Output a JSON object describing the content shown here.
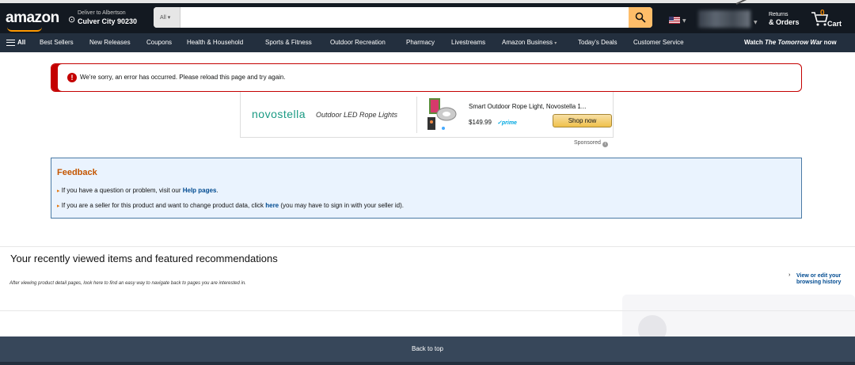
{
  "header": {
    "logo": "amazon",
    "deliver_line1": "Deliver to Albertson",
    "deliver_line2": "Culver City 90230",
    "search_category": "All",
    "search_value": "",
    "returns_line1": "Returns",
    "returns_line2": "& Orders",
    "cart_count": "0",
    "cart_label": "Cart"
  },
  "subnav": {
    "all": "All",
    "items": [
      "Best Sellers",
      "New Releases",
      "Coupons",
      "Health & Household",
      "Sports & Fitness",
      "Outdoor Recreation",
      "Pharmacy",
      "Livestreams",
      "Amazon Business",
      "Today's Deals",
      "Customer Service"
    ],
    "promo_prefix": "Watch ",
    "promo_title": "The Tomorrow War",
    "promo_suffix": " now"
  },
  "error": {
    "message": "We're sorry, an error has occurred. Please reload this page and try again."
  },
  "ad": {
    "brand": "novostella",
    "tagline": "Outdoor LED Rope Lights",
    "product_title": "Smart Outdoor Rope Light, Novostella 1...",
    "price": "$149.99",
    "prime": "prime",
    "shop_button": "Shop now",
    "sponsored": "Sponsored"
  },
  "feedback": {
    "title": "Feedback",
    "line1_prefix": "If you have a question or problem, visit our ",
    "line1_link": "Help pages",
    "line1_suffix": ".",
    "line2_prefix": "If you are a seller for this product and want to change product data, click ",
    "line2_link": "here",
    "line2_suffix": " (you may have to sign in with your seller id)."
  },
  "recently_viewed": {
    "title": "Your recently viewed items and featured recommendations",
    "subtitle": "After viewing product detail pages, look here to find an easy way to navigate back to pages you are interested in.",
    "edit_link": "View or edit your browsing history"
  },
  "footer": {
    "back_to_top": "Back to top"
  },
  "colors": {
    "nav_dark": "#131921",
    "nav_sub": "#232f3e",
    "accent": "#febd69",
    "error": "#c40000",
    "link": "#004b91"
  }
}
